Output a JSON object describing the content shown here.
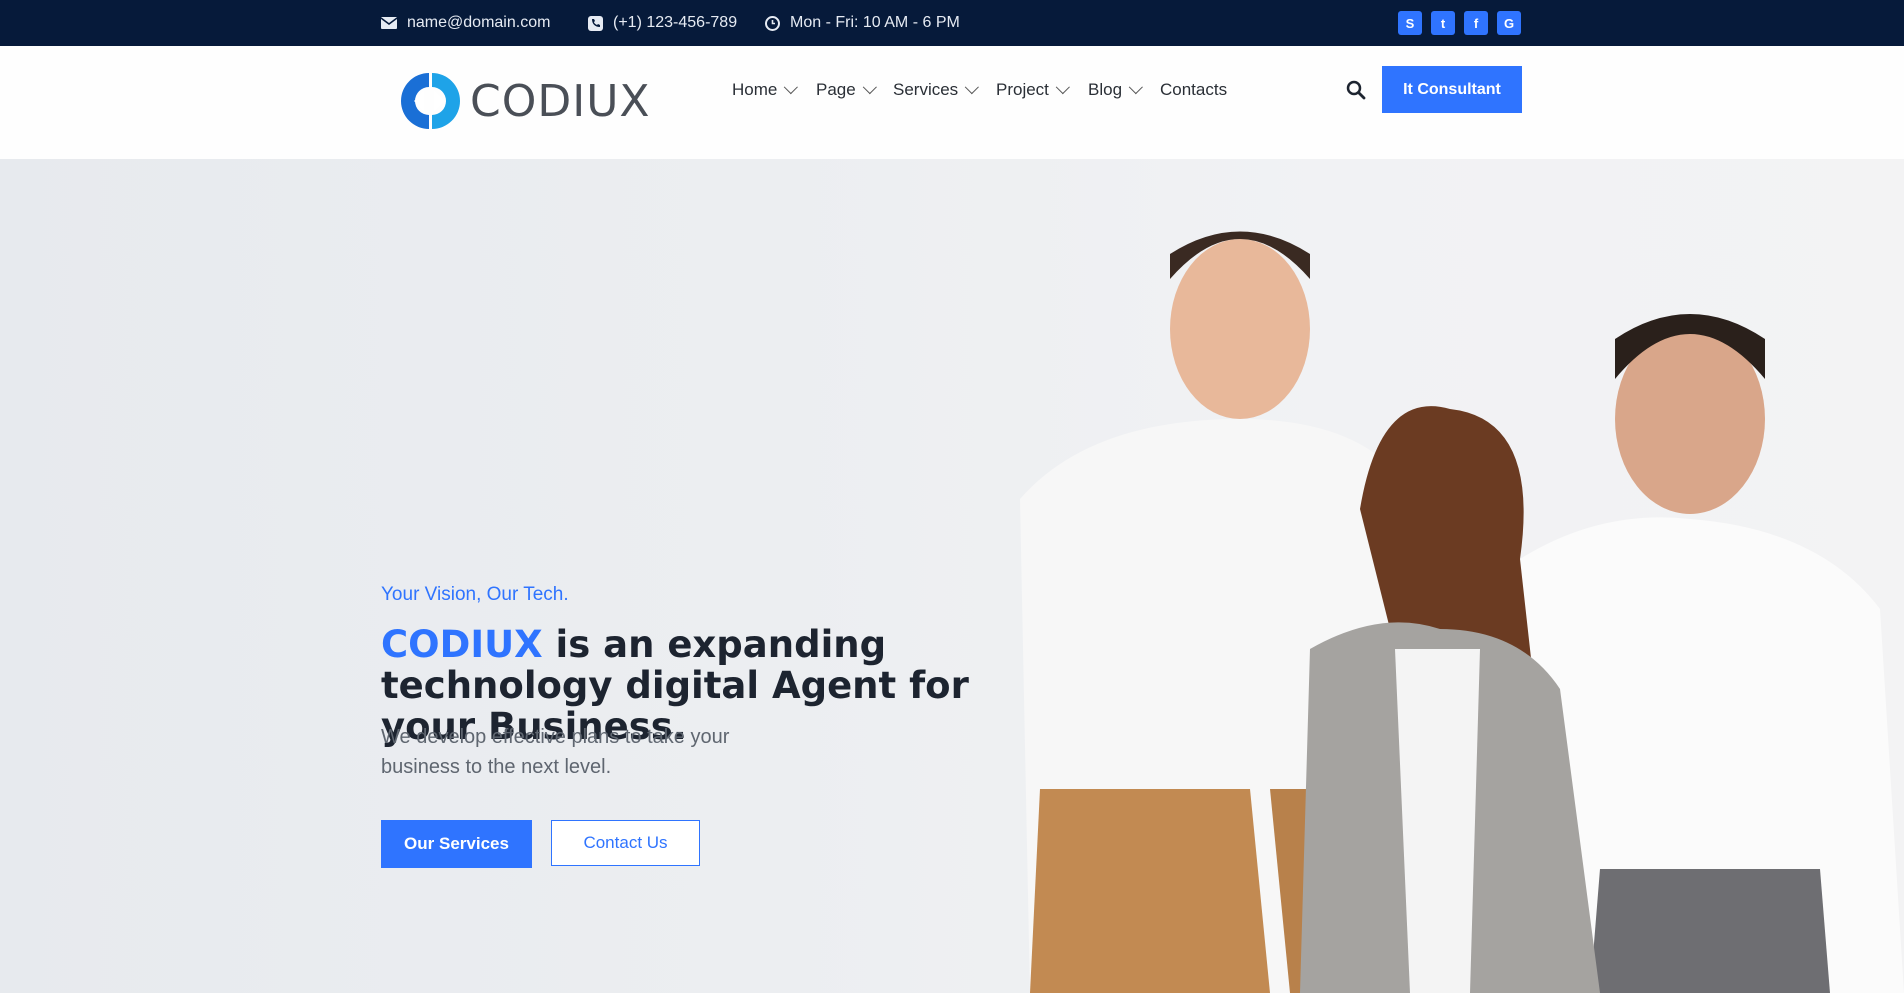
{
  "topbar": {
    "email": "name@domain.com",
    "phone": "(+1) 123-456-789",
    "hours": "Mon - Fri: 10 AM - 6 PM",
    "social": [
      "skype-icon",
      "twitter-icon",
      "facebook-icon",
      "google-icon"
    ],
    "social_glyphs": {
      "skype": "S",
      "twitter": "t",
      "facebook": "f",
      "google": "G"
    }
  },
  "header": {
    "logo_text": "CODIUX",
    "nav": [
      "Home",
      "Page",
      "Services",
      "Project",
      "Blog",
      "Contacts"
    ],
    "cta": "It Consultant"
  },
  "hero": {
    "tagline": "Your Vision, Our Tech.",
    "headline_brand": "CODIUX",
    "headline_rest": " is an expanding technology digital Agent for your Business.",
    "subtext": "We develop effective plans to take your business to the next level.",
    "primary_button": "Our Services",
    "secondary_button": "Contact Us"
  },
  "colors": {
    "topbar_bg": "#061a3a",
    "accent": "#2f74ff",
    "heading": "#1d2430"
  }
}
